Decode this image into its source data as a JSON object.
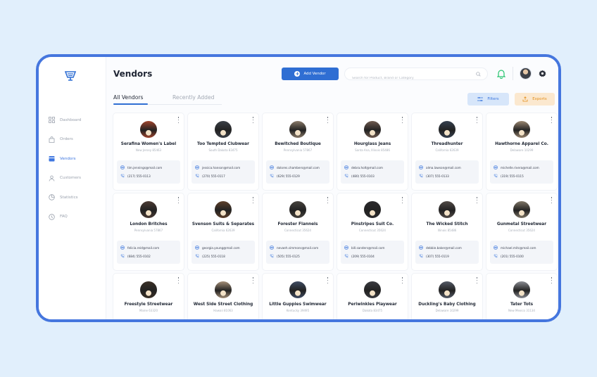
{
  "app": {
    "page_title": "Vendors",
    "add_vendor_label": "Add Vendor",
    "search_placeholder": "Search for Product, Brand or Category",
    "accent_color": "#2f6ed3",
    "icons": {
      "logo": "cart-logo-icon",
      "search": "search-icon",
      "notification": "bell-icon",
      "settings": "gear-icon",
      "email": "mail-icon",
      "phone": "phone-icon"
    }
  },
  "sidebar": {
    "items": [
      {
        "label": "Dashboard",
        "icon": "grid-icon",
        "active": false
      },
      {
        "label": "Orders",
        "icon": "bag-icon",
        "active": false
      },
      {
        "label": "Vendors",
        "icon": "store-icon",
        "active": true
      },
      {
        "label": "Customers",
        "icon": "user-icon",
        "active": false
      },
      {
        "label": "Statistics",
        "icon": "chart-icon",
        "active": false
      },
      {
        "label": "FAQ",
        "icon": "help-icon",
        "active": false
      }
    ]
  },
  "tabs": {
    "all": "All Vendors",
    "recent": "Recently Added"
  },
  "toolbar": {
    "filters_label": "Filters",
    "exports_label": "Exports"
  },
  "vendors": [
    {
      "name": "Serafina Women's Label",
      "location": "New Jersey 85463",
      "email": "tim.jennings@mail.com",
      "phone": "(217) 555-0113",
      "color": "#a0442c"
    },
    {
      "name": "Too Tempted Clubwear",
      "location": "South Dakota 83475",
      "email": "jessica.hanson@mail.com",
      "phone": "(270) 555-0117",
      "color": "#3b3f46"
    },
    {
      "name": "Bewitched Boutique",
      "location": "Pennsylvania 57867",
      "email": "dolores.chambers@mail.com",
      "phone": "(629) 555-0129",
      "color": "#8a7a69"
    },
    {
      "name": "Hourglass Jeans",
      "location": "Santa Ana, Illinois 85486",
      "email": "debra.holt@mail.com",
      "phone": "(480) 555-0103",
      "color": "#6f5a4f"
    },
    {
      "name": "Threadhunter",
      "location": "California 62639",
      "email": "alma.lawson@mail.com",
      "phone": "(307) 555-0133",
      "color": "#35404f"
    },
    {
      "name": "Hawthorne Apparel Co.",
      "location": "Delaware 10299",
      "email": "michelle.rivera@mail.com",
      "phone": "(319) 555-0115",
      "color": "#9a8670"
    },
    {
      "name": "London Britches",
      "location": "Pennsylvania 57867",
      "email": "felicia.reid@mail.com",
      "phone": "(684) 555-0102",
      "color": "#4a3a33"
    },
    {
      "name": "Svenson Suits & Separates",
      "location": "California 62639",
      "email": "georgia.young@mail.com",
      "phone": "(225) 555-0118",
      "color": "#5d3f2a"
    },
    {
      "name": "Forester Flannels",
      "location": "Connecticut 35624",
      "email": "nevaeh.simmons@mail.com",
      "phone": "(505) 555-0125",
      "color": "#46423d"
    },
    {
      "name": "Pinstripes Suit Co.",
      "location": "Connecticut 35624",
      "email": "bill.sanders@mail.com",
      "phone": "(209) 555-0104",
      "color": "#2b2a2c"
    },
    {
      "name": "The Wicked Stitch",
      "location": "Illinois 85486",
      "email": "debbie.baker@mail.com",
      "phone": "(307) 555-0119",
      "color": "#514a46"
    },
    {
      "name": "Gunmetal Streetwear",
      "location": "Connecticut 35624",
      "email": "michael.mitc@mail.com",
      "phone": "(201) 555-0100",
      "color": "#7e7566"
    },
    {
      "name": "Freestyle Streetwear",
      "location": "Maine 63320",
      "email": "",
      "phone": "",
      "color": "#3a3026"
    },
    {
      "name": "West Side Street Clothing",
      "location": "Hawaii 81063",
      "email": "",
      "phone": "",
      "color": "#a48f78"
    },
    {
      "name": "Little Guppies Swimwear",
      "location": "Kentucky 39495",
      "email": "",
      "phone": "",
      "color": "#3f4c63"
    },
    {
      "name": "Periwinkles Playwear",
      "location": "Dakota 83475",
      "email": "",
      "phone": "",
      "color": "#3a3b40"
    },
    {
      "name": "Duckling's Baby Clothing",
      "location": "Delaware 10299",
      "email": "",
      "phone": "",
      "color": "#545a66"
    },
    {
      "name": "Tater Tots",
      "location": "New Mexico 31134",
      "email": "",
      "phone": "",
      "color": "#8b8d93"
    }
  ]
}
